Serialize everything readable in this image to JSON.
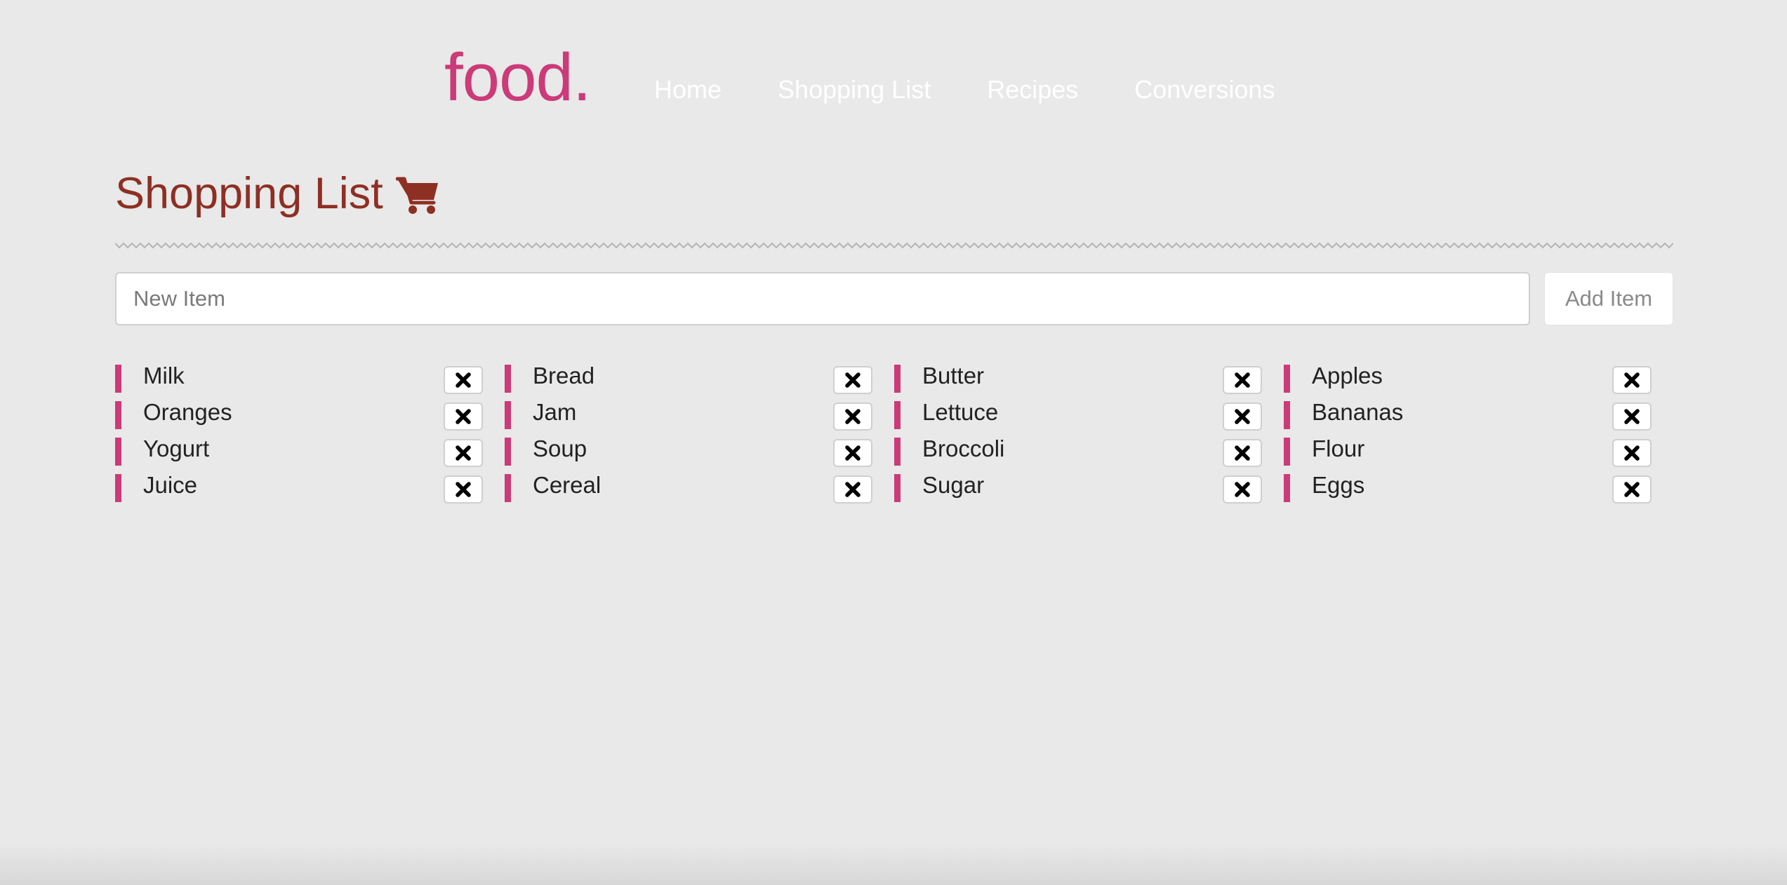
{
  "brand": {
    "logo": "food.",
    "accent_color": "#cc3a78"
  },
  "nav": {
    "items": [
      {
        "label": "Home"
      },
      {
        "label": "Shopping List"
      },
      {
        "label": "Recipes"
      },
      {
        "label": "Conversions"
      }
    ]
  },
  "page": {
    "title": "Shopping List",
    "title_icon": "shopping-cart-icon",
    "title_color": "#8e2f24"
  },
  "add_form": {
    "input_placeholder": "New Item",
    "input_value": "",
    "button_label": "Add Item"
  },
  "items": [
    {
      "label": "Milk"
    },
    {
      "label": "Bread"
    },
    {
      "label": "Butter"
    },
    {
      "label": "Apples"
    },
    {
      "label": "Oranges"
    },
    {
      "label": "Jam"
    },
    {
      "label": "Lettuce"
    },
    {
      "label": "Bananas"
    },
    {
      "label": "Yogurt"
    },
    {
      "label": "Soup"
    },
    {
      "label": "Broccoli"
    },
    {
      "label": "Flour"
    },
    {
      "label": "Juice"
    },
    {
      "label": "Cereal"
    },
    {
      "label": "Sugar"
    },
    {
      "label": "Eggs"
    }
  ],
  "remove_icon": "close-x-icon"
}
